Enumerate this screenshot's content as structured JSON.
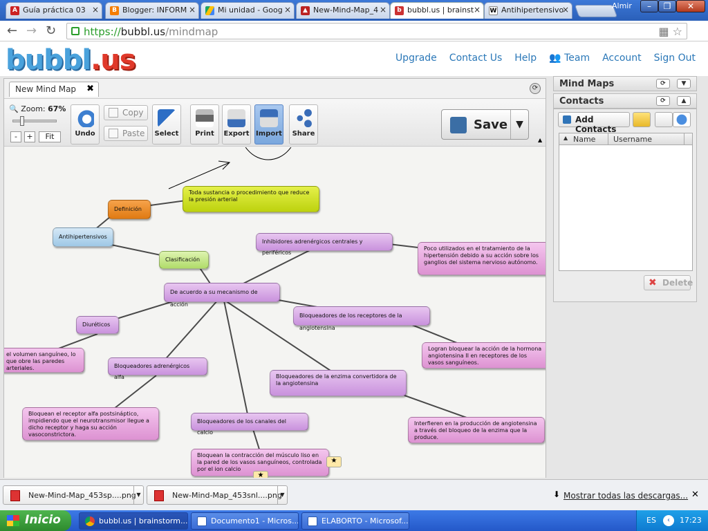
{
  "browser": {
    "tabs": [
      {
        "label": "Guía práctica 03",
        "icon": "pdf"
      },
      {
        "label": "Blogger: INFORM",
        "icon": "blogger"
      },
      {
        "label": "Mi unidad - Goog",
        "icon": "drive"
      },
      {
        "label": "New-Mind-Map_4",
        "icon": "image"
      },
      {
        "label": "bubbl.us | brainst",
        "icon": "bubbl"
      },
      {
        "label": "Antihipertensivo",
        "icon": "wikipedia"
      }
    ],
    "user": "Almir",
    "url_scheme": "https://",
    "url_host": "bubbl.us",
    "url_path": "/mindmap"
  },
  "app": {
    "logo_main": "bubbl",
    "logo_dot": ".us",
    "nav": [
      "Upgrade",
      "Contact Us",
      "Help",
      "Team",
      "Account",
      "Sign Out"
    ]
  },
  "editor": {
    "doc_tab": "New Mind Map",
    "zoom_label": "Zoom:",
    "zoom_value": "67%",
    "zoom_fraction": 0.18,
    "zoom_minus": "-",
    "zoom_plus": "+",
    "zoom_fit": "Fit",
    "tools": {
      "undo": "Undo",
      "copy": "Copy",
      "paste": "Paste",
      "select": "Select",
      "print": "Print",
      "export": "Export",
      "import": "Import",
      "share": "Share",
      "save": "Save"
    }
  },
  "mindmap": {
    "nodes": [
      {
        "id": "definicion",
        "text": "Definición",
        "color": "orange"
      },
      {
        "id": "def_text",
        "text": "Toda sustancia o procedimiento que reduce la presión arterial",
        "color": "yellow"
      },
      {
        "id": "antihipertensivos",
        "text": "Antihipertensivos",
        "color": "blue"
      },
      {
        "id": "clasificacion",
        "text": "Clasificación",
        "color": "green"
      },
      {
        "id": "mecanismo",
        "text": "De acuerdo a su mecanismo de acción",
        "color": "purple"
      },
      {
        "id": "inhibidores",
        "text": "Inhibidores adrenérgicos centrales y periféricos",
        "color": "purple"
      },
      {
        "id": "inhibidores_desc",
        "text": "Poco utilizados en el tratamiento de la hipertensión debido a su acción sobre los ganglios del sistema nervioso autónomo.",
        "color": "pink"
      },
      {
        "id": "bloq_receptores",
        "text": "Bloqueadores de los receptores de la angiotensina",
        "color": "purple"
      },
      {
        "id": "bloq_receptores_desc",
        "text": "Logran bloquear la acción de la hormona angiotensina II en receptores de los vasos sanguíneos.",
        "color": "pink"
      },
      {
        "id": "diureticos",
        "text": "Diuréticos",
        "color": "purple"
      },
      {
        "id": "diureticos_desc",
        "text": "el volumen sanguíneo, lo que obre las paredes arteriales.",
        "color": "pink"
      },
      {
        "id": "bloq_alfa",
        "text": "Bloqueadores adrenérgicos alfa",
        "color": "purple"
      },
      {
        "id": "bloq_alfa_desc",
        "text": "Bloquean el receptor alfa postsináptico, impidiendo que el neurotransmisor llegue a dicho receptor y haga su acción vasoconstrictora.",
        "color": "pink"
      },
      {
        "id": "bloq_enzima",
        "text": "Bloqueadores de la enzima convertidora de la angiotensina",
        "color": "purple"
      },
      {
        "id": "bloq_enzima_desc",
        "text": "Interfieren en la producción de angiotensina a través del bloqueo de la enzima que la produce.",
        "color": "pink"
      },
      {
        "id": "bloq_calcio",
        "text": "Bloqueadores de los canales del calcio",
        "color": "purple"
      },
      {
        "id": "bloq_calcio_desc",
        "text": "Bloquean la contracción del músculo liso en la pared de los vasos sanguíneos, controlada por el ion calcio",
        "color": "pink"
      }
    ],
    "colors": {
      "line": "#4a4a4a",
      "annotation": "#000000"
    }
  },
  "sidebar": {
    "mindmaps_title": "Mind Maps",
    "contacts_title": "Contacts",
    "add_contacts": "Add Contacts",
    "col_name": "Name",
    "col_username": "Username",
    "delete": "Delete"
  },
  "downloads": {
    "items": [
      "New-Mind-Map_453sp....png",
      "New-Mind-Map_453snl....png"
    ],
    "show_all": "Mostrar todas las descargas..."
  },
  "taskbar": {
    "start": "Inicio",
    "items": [
      {
        "label": "bubbl.us | brainstorm...",
        "icon": "chrome"
      },
      {
        "label": "Documento1 - Micros...",
        "icon": "word"
      },
      {
        "label": "ELABORTO - Microsof...",
        "icon": "word"
      }
    ],
    "lang": "ES",
    "clock": "17:23"
  }
}
